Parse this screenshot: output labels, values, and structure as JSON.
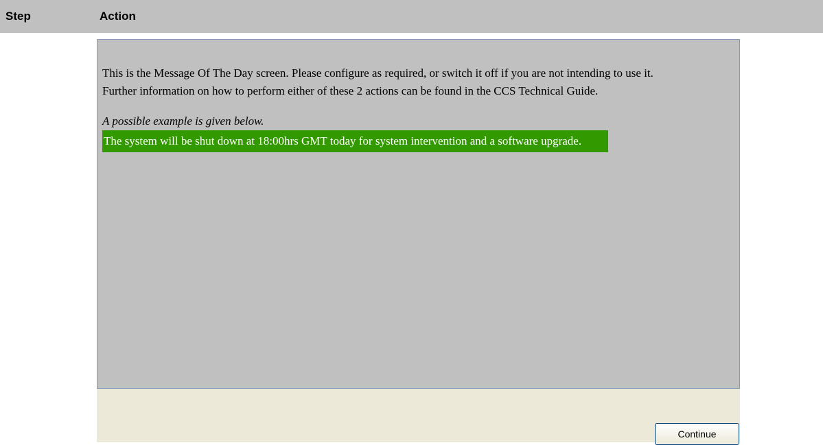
{
  "table_header": {
    "step": "Step",
    "action": "Action"
  },
  "motd": {
    "line1": "This is the Message Of The Day screen. Please configure as required, or switch it off if you are not intending to use it.",
    "line2": "Further information on how to perform either of these 2 actions can be found in the CCS Technical Guide.",
    "example_label": "A possible example is given below.",
    "example_message": "The system will be shut down at 18:00hrs GMT today for system intervention and a software upgrade.",
    "highlight_color": "#339900"
  },
  "buttons": {
    "continue": "Continue"
  }
}
